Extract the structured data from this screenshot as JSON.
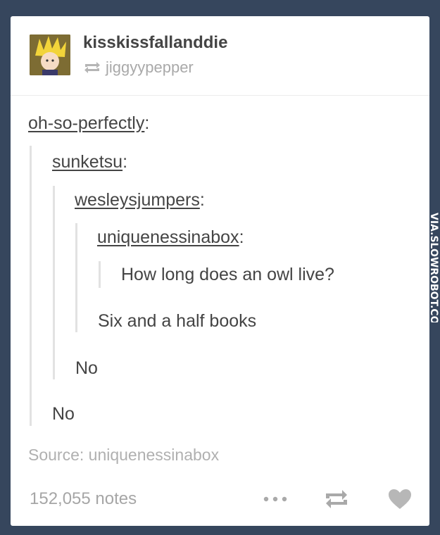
{
  "post": {
    "blog_name": "kisskissfallanddie",
    "reblogged_from": "jiggyypepper",
    "thread": {
      "user1": "oh-so-perfectly",
      "user2": "sunketsu",
      "user3": "wesleysjumpers",
      "user4": "uniquenessinabox",
      "question": "How long does an owl live?",
      "answer1": "Six and a half books",
      "answer2": "No",
      "answer3": "No"
    },
    "colon": ":",
    "source_label": "Source: uniquenessinabox",
    "notes": "152,055 notes"
  },
  "icons": {
    "reblog_small": "reblog-icon",
    "more": "ellipsis-icon",
    "reblog": "reblog-icon",
    "like": "heart-icon"
  },
  "watermark": "VIA.SLOWROBOT.COM",
  "colors": {
    "background": "#36465d",
    "card": "#ffffff",
    "text": "#444444",
    "muted": "#a9a9a9",
    "rule": "#e2e2e2"
  }
}
